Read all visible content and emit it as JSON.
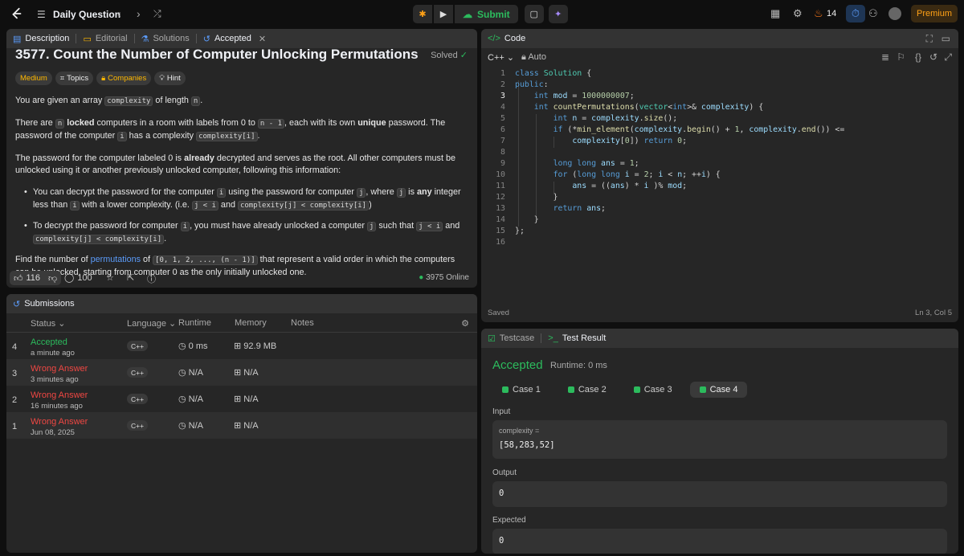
{
  "topbar": {
    "title": "Daily Question",
    "submit_label": "Submit",
    "streak": "14",
    "premium_label": "Premium"
  },
  "description": {
    "tabs": [
      {
        "label": "Description",
        "icon": "document-icon"
      },
      {
        "label": "Editorial",
        "icon": "book-icon"
      },
      {
        "label": "Solutions",
        "icon": "flask-icon"
      },
      {
        "label": "Accepted",
        "icon": "history-icon"
      }
    ],
    "title": "3577. Count the Number of Computer Unlocking Permutations",
    "solved_label": "Solved",
    "chips": [
      "Medium",
      "Topics",
      "Companies",
      "Hint"
    ],
    "p1a": "You are given an array ",
    "p1code": "complexity",
    "p1b": " of length ",
    "p1code2": "n",
    "p1c": ".",
    "p2a": "There are ",
    "p2code": "n",
    "p2bold": "locked",
    "p2b": " computers in a room with labels from 0 to ",
    "p2code2": "n - 1",
    "p2c": ", each with its own ",
    "p2bold2": "unique",
    "p2d": " password. The password of the computer ",
    "p2code3": "i",
    "p2e": " has a complexity ",
    "p2code4": "complexity[i]",
    "p2f": ".",
    "p3a": "The password for the computer labeled 0 is ",
    "p3bold": "already",
    "p3b": " decrypted and serves as the root. All other computers must be unlocked using it or another previously unlocked computer, following this information:",
    "b1a": "You can decrypt the password for the computer ",
    "b1code": "i",
    "b1b": " using the password for computer ",
    "b1code2": "j",
    "b1c": ", where ",
    "b1code3": "j",
    "b1d": " is ",
    "b1bold": "any",
    "b1e": " integer less than ",
    "b1code4": "i",
    "b1f": " with a lower complexity. (i.e. ",
    "b1code5": "j < i",
    "b1g": " and ",
    "b1code6": "complexity[j] < complexity[i]",
    "b1h": ")",
    "b2a": "To decrypt the password for computer ",
    "b2code": "i",
    "b2b": ", you must have already unlocked a computer ",
    "b2code2": "j",
    "b2c": " such that ",
    "b2code3": "j < i",
    "b2d": " and ",
    "b2code4": "complexity[j] < complexity[i]",
    "b2e": ".",
    "p4a": "Find the number of ",
    "p4link": "permutations",
    "p4b": " of ",
    "p4code": "[0, 1, 2, ..., (n - 1)]",
    "p4c": " that represent a valid order in which the computers can be unlocked, starting from computer 0 as the only initially unlocked one.",
    "likes": "116",
    "comments": "100",
    "online": "3975 Online"
  },
  "submissions": {
    "title": "Submissions",
    "columns": [
      "Status",
      "Language",
      "Runtime",
      "Memory",
      "Notes"
    ],
    "rows": [
      {
        "num": "4",
        "status": "Accepted",
        "time": "a minute ago",
        "lang": "C++",
        "runtime": "0 ms",
        "memory": "92.9 MB"
      },
      {
        "num": "3",
        "status": "Wrong Answer",
        "time": "3 minutes ago",
        "lang": "C++",
        "runtime": "N/A",
        "memory": "N/A"
      },
      {
        "num": "2",
        "status": "Wrong Answer",
        "time": "16 minutes ago",
        "lang": "C++",
        "runtime": "N/A",
        "memory": "N/A"
      },
      {
        "num": "1",
        "status": "Wrong Answer",
        "time": "Jun 08, 2025",
        "lang": "C++",
        "runtime": "N/A",
        "memory": "N/A"
      }
    ]
  },
  "code": {
    "title": "Code",
    "language": "C++",
    "mode": "Auto",
    "line_numbers": [
      "1",
      "2",
      "3",
      "4",
      "5",
      "6",
      "7",
      "8",
      "9",
      "10",
      "11",
      "12",
      "13",
      "14",
      "15",
      "16"
    ],
    "status": "Saved",
    "cursor": "Ln 3, Col 5"
  },
  "test": {
    "tabs": [
      "Testcase",
      "Test Result"
    ],
    "result": "Accepted",
    "runtime": "Runtime: 0 ms",
    "cases": [
      "Case 1",
      "Case 2",
      "Case 3",
      "Case 4"
    ],
    "input_label": "Input",
    "input_var": "complexity =",
    "input_val": "[58,283,52]",
    "output_label": "Output",
    "output_val": "0",
    "expected_label": "Expected",
    "expected_val": "0"
  },
  "colors": {
    "accepted": "#2cbb5d",
    "wrong": "#ef4743",
    "premium": "#ffa116",
    "link": "#5b9bf9"
  }
}
